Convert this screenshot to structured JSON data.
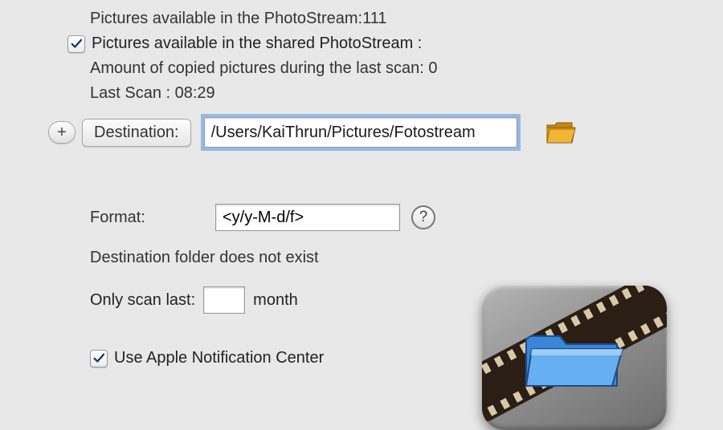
{
  "info": {
    "photostream_count_label": "Pictures available in the PhotoStream:",
    "photostream_count": "111",
    "shared_photostream_label": "Pictures available in the shared PhotoStream :",
    "copied_count_label": "Amount of copied pictures during the last scan: ",
    "copied_count": "0",
    "last_scan_label": "Last Scan : ",
    "last_scan_time": "08:29"
  },
  "destination": {
    "button_label": "Destination:",
    "path": "/Users/KaiThrun/Pictures/Fotostream"
  },
  "format": {
    "label": "Format:",
    "value": "<y/y-M-d/f>",
    "warning": "Destination folder does not exist"
  },
  "scan": {
    "label_pre": "Only scan last:",
    "value": "",
    "label_post": "month"
  },
  "notification": {
    "label": "Use Apple Notification Center"
  },
  "icons": {
    "plus": "+",
    "help": "?"
  }
}
